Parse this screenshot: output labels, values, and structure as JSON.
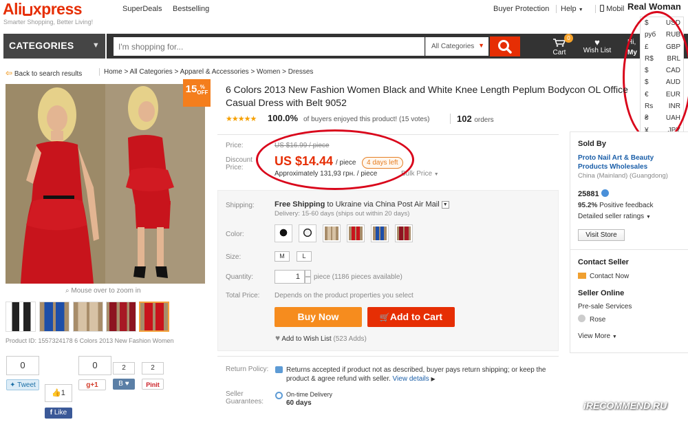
{
  "header": {
    "logo_a": "Ali",
    "logo_b": "xpress",
    "tagline": "Smarter Shopping, Better Living!",
    "nav": [
      "SuperDeals",
      "Bestselling"
    ],
    "buyer_protection": "Buyer Protection",
    "help": "Help",
    "mobile": "Mobil",
    "overlay_title": "Real Woman"
  },
  "searchbar": {
    "categories_label": "CATEGORIES",
    "placeholder": "I'm shopping for...",
    "category_select": "All Categories",
    "cart_label": "Cart",
    "cart_count": "0",
    "wish_label": "Wish List",
    "hi_line1": "Hi,",
    "hi_line2": "My"
  },
  "currency_menu": [
    {
      "symbol": "$",
      "code": "USD"
    },
    {
      "symbol": "руб",
      "code": "RUB"
    },
    {
      "symbol": "£",
      "code": "GBP"
    },
    {
      "symbol": "R$",
      "code": "BRL"
    },
    {
      "symbol": "$",
      "code": "CAD"
    },
    {
      "symbol": "$",
      "code": "AUD"
    },
    {
      "symbol": "€",
      "code": "EUR"
    },
    {
      "symbol": "Rs",
      "code": "INR"
    },
    {
      "symbol": "₴",
      "code": "UAH"
    },
    {
      "symbol": "¥",
      "code": "JPY"
    }
  ],
  "breadcrumb": {
    "back": "Back to search results",
    "path": "Home > All Categories > Apparel & Accessories > Women > Dresses"
  },
  "gallery": {
    "discount_pct": "15",
    "discount_unit": "%",
    "discount_off": "OFF",
    "zoom_hint": "Mouse over to zoom in",
    "product_id": "Product ID: 1557324178 6 Colors 2013 New Fashion Women"
  },
  "social": {
    "tweet_count": "0",
    "tweet_label": "Tweet",
    "gplus_count": "0",
    "gplus_label": "g+1",
    "vk_count": "2",
    "pin_count": "2",
    "pin_label": "Pinit",
    "like_count": "1",
    "like_label": "Like"
  },
  "product": {
    "title": "6 Colors 2013 New Fashion Women Black and White Knee Length Peplum Bodycon OL Office Casual Dress with Belt 9052",
    "rating_pct": "100.0%",
    "rating_text": "of buyers enjoyed this product! (15 votes)",
    "orders_count": "102",
    "orders_label": "orders",
    "price_label": "Price:",
    "old_price": "US $16.99 / piece",
    "discount_label_1": "Discount",
    "discount_label_2": "Price:",
    "new_price": "US $14.44",
    "per_piece": "/ piece",
    "days_left": "4 days left",
    "approx": "Approximately 131,93 грн. / piece",
    "bulk": "Bulk Price"
  },
  "options": {
    "shipping_label": "Shipping:",
    "free_shipping": "Free Shipping",
    "ship_to": "to Ukraine via China Post Air Mail",
    "delivery": "Delivery: 15-60 days (ships out within 20 days)",
    "color_label": "Color:",
    "size_label": "Size:",
    "sizes": [
      "M",
      "L"
    ],
    "quantity_label": "Quantity:",
    "quantity": "1",
    "qty_text": "piece (1186 pieces available)",
    "total_label": "Total Price:",
    "total_text": "Depends on the product properties you select",
    "buy_now": "Buy Now",
    "add_to_cart": "Add to Cart",
    "wishlist": "Add to Wish List",
    "wishlist_count": "(523 Adds)"
  },
  "policy": {
    "return_label": "Return Policy:",
    "return_text": "Returns accepted if product not as described, buyer pays return shipping; or keep the product & agree refund with seller.",
    "view_details": "View details",
    "guarantee_label_1": "Seller",
    "guarantee_label_2": "Guarantees:",
    "on_time": "On-time Delivery",
    "days": "60 days"
  },
  "seller": {
    "sold_by": "Sold By",
    "name_1": "Proto Nail Art & Beauty",
    "name_2": "Products Wholesales",
    "location": "China (Mainland) (Guangdong)",
    "score": "25881",
    "feedback_pct": "95.2%",
    "feedback_text": "Positive feedback",
    "detailed": "Detailed seller ratings",
    "visit": "Visit Store",
    "contact_h": "Contact Seller",
    "contact_now": "Contact Now",
    "online_h": "Seller Online",
    "presale": "Pre-sale Services",
    "rep": "Rose",
    "view_more": "View More"
  },
  "watermark": "iRECOMMEND.RU",
  "colors": {
    "brand": "#e62e04",
    "buy_now": "#f68c1e",
    "annotation": "#d9061b"
  }
}
